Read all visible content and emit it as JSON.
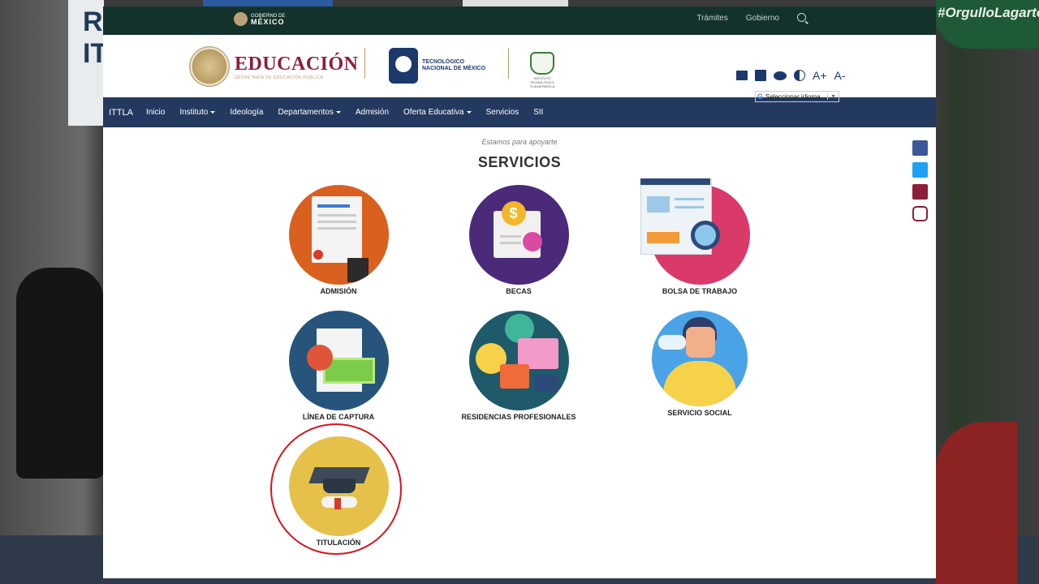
{
  "background": {
    "left_banner_text": "R\nIT",
    "right_banner_text": "#OrgulloLagarto"
  },
  "gov_bar": {
    "logo_small": "GOBIERNO DE",
    "logo_big": "MÉXICO",
    "links": [
      "Trámites",
      "Gobierno"
    ]
  },
  "header": {
    "edu_name": "EDUCACIÓN",
    "edu_sub": "SECRETARÍA DE EDUCACIÓN PÚBLICA",
    "tec_line1": "TECNOLÓGICO",
    "tec_line2": "NACIONAL DE MÉXICO",
    "ittla_text": "INSTITUTO TECNOLÓGICO TLALNEPANTLA",
    "font_plus": "A+",
    "font_minus": "A-",
    "language_select": "Seleccionar idioma"
  },
  "navbar": {
    "brand": "ITTLA",
    "items": [
      {
        "label": "Inicio",
        "dropdown": false
      },
      {
        "label": "Instituto",
        "dropdown": true
      },
      {
        "label": "Ideología",
        "dropdown": false
      },
      {
        "label": "Departamentos",
        "dropdown": true
      },
      {
        "label": "Admisión",
        "dropdown": false
      },
      {
        "label": "Oferta Educativa",
        "dropdown": true
      },
      {
        "label": "Servicios",
        "dropdown": false
      },
      {
        "label": "SII",
        "dropdown": false
      }
    ]
  },
  "content": {
    "tagline": "Estamos para apoyarte",
    "title": "SERVICIOS",
    "services": [
      {
        "label": "ADMISIÓN",
        "color": "#d9601e"
      },
      {
        "label": "BECAS",
        "color": "#4b2a7a"
      },
      {
        "label": "BOLSA DE TRABAJO",
        "color": "#d93a6a"
      },
      {
        "label": "LÍNEA DE CAPTURA",
        "color": "#27547a"
      },
      {
        "label": "RESIDENCIAS PROFESIONALES",
        "color": "#1f5a6a"
      },
      {
        "label": "SERVICIO SOCIAL",
        "color": "#4aa3e6"
      },
      {
        "label": "TITULACIÓN",
        "color": "#e6c14a",
        "highlighted": true
      }
    ]
  },
  "social": [
    "facebook",
    "twitter",
    "youtube",
    "instagram"
  ]
}
